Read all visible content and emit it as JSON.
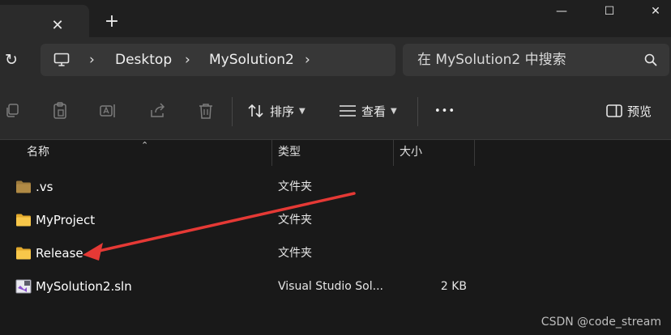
{
  "window": {
    "tab_close_glyph": "✕",
    "new_tab_glyph": "+",
    "minimize_glyph": "—",
    "maximize_glyph": "☐",
    "close_glyph": "✕"
  },
  "address": {
    "refresh_glyph": "↻",
    "crumbs": [
      "Desktop",
      "MySolution2"
    ],
    "chevron": "›"
  },
  "search": {
    "placeholder": "在 MySolution2 中搜索"
  },
  "toolbar": {
    "sort_label": "排序",
    "view_label": "查看",
    "more_label": "•••",
    "preview_label": "预览"
  },
  "columns": {
    "name": "名称",
    "type": "类型",
    "size": "大小"
  },
  "files": [
    {
      "name": ".vs",
      "type": "文件夹",
      "size": "",
      "icon": "folder-dim-icon"
    },
    {
      "name": "MyProject",
      "type": "文件夹",
      "size": "",
      "icon": "folder-icon"
    },
    {
      "name": "Release",
      "type": "文件夹",
      "size": "",
      "icon": "folder-icon"
    },
    {
      "name": "MySolution2.sln",
      "type": "Visual Studio Sol...",
      "size": "2 KB",
      "icon": "vs-solution-icon"
    }
  ],
  "watermark": "CSDN @code_stream",
  "colors": {
    "background": "#191919",
    "chrome": "#2b2b2b",
    "folder": "#f8c74a",
    "annotation_arrow": "#e53935"
  }
}
